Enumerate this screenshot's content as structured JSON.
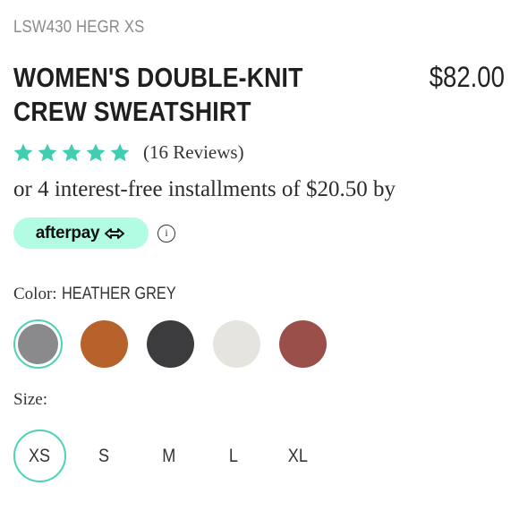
{
  "product": {
    "sku": "LSW430 HEGR XS",
    "title": "WOMEN'S DOUBLE-KNIT CREW SWEATSHIRT",
    "price": "$82.00"
  },
  "rating": {
    "stars": 5,
    "reviews_text": "(16 Reviews)",
    "star_color": "#3fcfb0"
  },
  "installments": {
    "text": "or 4 interest-free installments of $20.50 by",
    "provider_label": "afterpay",
    "badge_color": "#b2fce4",
    "info_icon": "ⓘ"
  },
  "color": {
    "label": "Color:",
    "selected_value": "HEATHER GREY",
    "swatches": [
      {
        "name": "heather-grey",
        "hex": "#8a8a8c",
        "selected": true
      },
      {
        "name": "rust",
        "hex": "#b8622b",
        "selected": false
      },
      {
        "name": "charcoal",
        "hex": "#3c3c3e",
        "selected": false
      },
      {
        "name": "cream",
        "hex": "#e6e4df",
        "selected": false
      },
      {
        "name": "mauve-brown",
        "hex": "#9a4f4a",
        "selected": false
      }
    ]
  },
  "size": {
    "label": "Size:",
    "options": [
      "XS",
      "S",
      "M",
      "L",
      "XL"
    ],
    "selected": "XS"
  },
  "accent_color": "#4fd1b5"
}
